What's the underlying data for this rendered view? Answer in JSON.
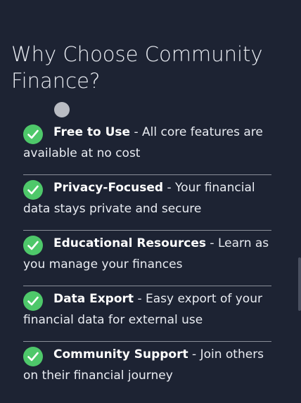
{
  "section": {
    "title": "Why Choose Community Finance?"
  },
  "features": [
    {
      "title": "Free to Use",
      "separator": " - ",
      "description": "All core features are available at no cost"
    },
    {
      "title": "Privacy-Focused",
      "separator": " - ",
      "description": "Your financial data stays private and secure"
    },
    {
      "title": "Educational Resources",
      "separator": " - ",
      "description": "Learn as you manage your finances"
    },
    {
      "title": "Data Export",
      "separator": " - ",
      "description": "Easy export of your financial data for external use"
    },
    {
      "title": "Community Support",
      "separator": " - ",
      "description": "Join others on their financial journey"
    }
  ],
  "icons": {
    "check": "check-circle-icon"
  },
  "colors": {
    "background": "#1d2333",
    "check_green": "#4ec86a",
    "divider": "#8a8f99",
    "text": "#e9ecf2"
  }
}
